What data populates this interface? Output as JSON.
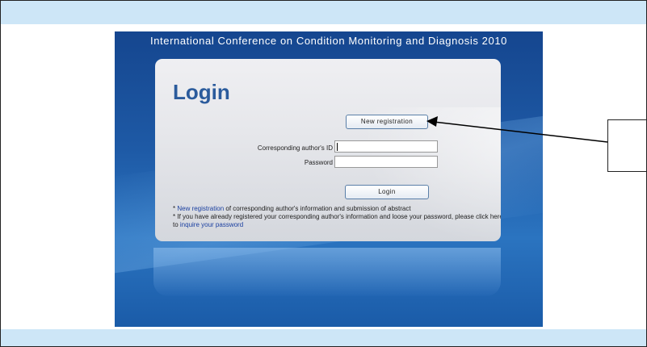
{
  "header": {
    "conference_title": "International Conference on Condition Monitoring and Diagnosis 2010"
  },
  "login": {
    "heading": "Login",
    "new_registration_button": "New registration",
    "id_label": "Corresponding author's ID",
    "password_label": "Password",
    "id_value": "",
    "password_value": "",
    "login_button": "Login"
  },
  "info": {
    "line1_bullet": "* ",
    "line1_link": "New registration",
    "line1_rest": " of corresponding author's information and submission of abstract",
    "line2_bullet": "* ",
    "line2_text": "If you have already registered your corresponding author's information and loose your password, please click here to ",
    "line2_link": "inquire your password"
  },
  "colors": {
    "band": "#cde6f7",
    "panel_blue": "#1e5aa6",
    "heading_blue": "#2b5b9c",
    "link_blue": "#1a3fa0"
  }
}
